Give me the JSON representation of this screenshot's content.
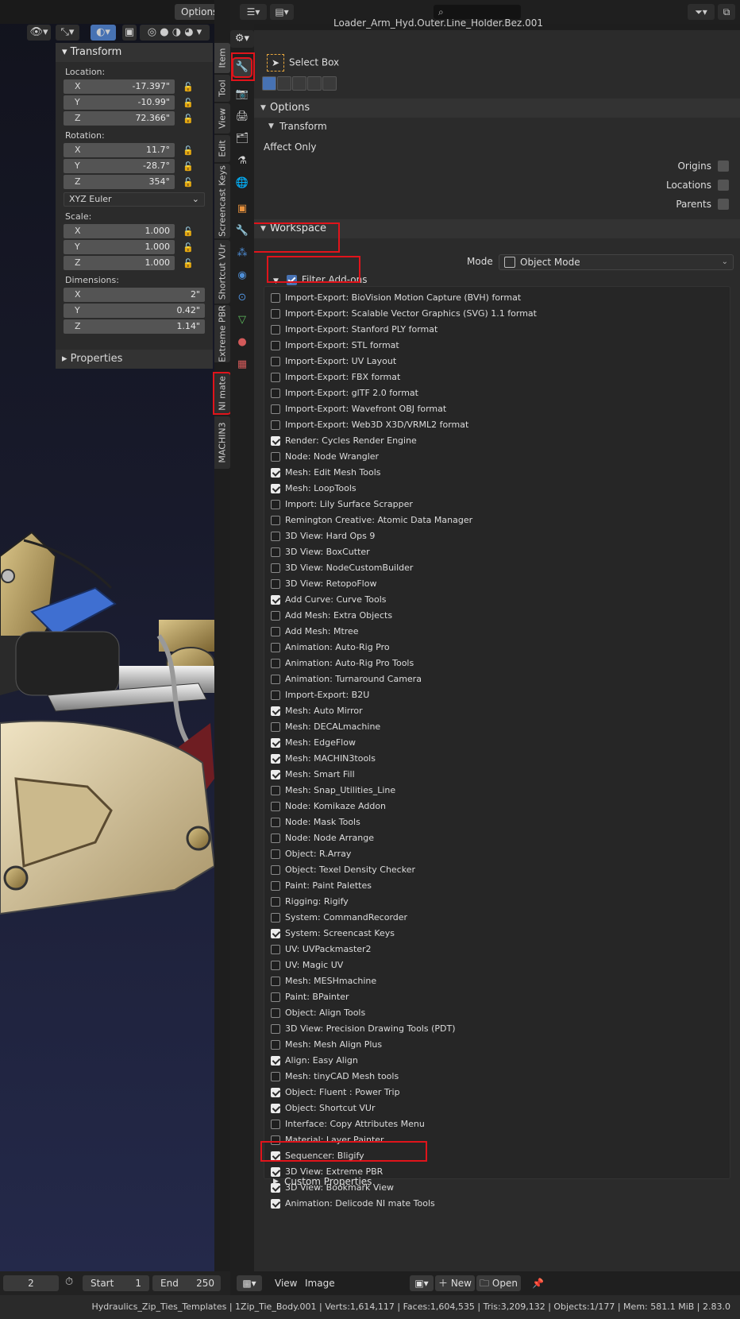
{
  "viewport": {
    "options_label": "Options"
  },
  "npanel": {
    "transform_header": "Transform",
    "location_label": "Location:",
    "location": [
      {
        "axis": "X",
        "value": "-17.397\""
      },
      {
        "axis": "Y",
        "value": "-10.99\""
      },
      {
        "axis": "Z",
        "value": "72.366\""
      }
    ],
    "rotation_label": "Rotation:",
    "rotation": [
      {
        "axis": "X",
        "value": "11.7°"
      },
      {
        "axis": "Y",
        "value": "-28.7°"
      },
      {
        "axis": "Z",
        "value": "354°"
      }
    ],
    "rotation_mode": "XYZ Euler",
    "scale_label": "Scale:",
    "scale": [
      {
        "axis": "X",
        "value": "1.000"
      },
      {
        "axis": "Y",
        "value": "1.000"
      },
      {
        "axis": "Z",
        "value": "1.000"
      }
    ],
    "dimensions_label": "Dimensions:",
    "dimensions": [
      {
        "axis": "X",
        "value": "2\""
      },
      {
        "axis": "Y",
        "value": "0.42\""
      },
      {
        "axis": "Z",
        "value": "1.14\""
      }
    ],
    "properties_header": "Properties"
  },
  "vtabs": [
    "Item",
    "Tool",
    "View",
    "Edit",
    "Screencast Keys",
    "Shortcut VUr",
    "Extreme PBR",
    "NI mate",
    "MACHIN3"
  ],
  "props_header": {
    "breadcrumb": "Loader_Arm_Hyd.Outer.Line_Holder.Bez.001"
  },
  "tool": {
    "active_tool": "Select Box"
  },
  "options": {
    "header": "Options",
    "transform_sub": "Transform",
    "affect_only": "Affect Only",
    "origins": "Origins",
    "locations": "Locations",
    "parents": "Parents"
  },
  "workspace": {
    "header": "Workspace",
    "mode_label": "Mode",
    "mode_value": "Object Mode",
    "filter_addons": "Filter Add-ons"
  },
  "addons": [
    {
      "name": "Import-Export: BioVision Motion Capture (BVH) format",
      "on": false
    },
    {
      "name": "Import-Export: Scalable Vector Graphics (SVG) 1.1 format",
      "on": false
    },
    {
      "name": "Import-Export: Stanford PLY format",
      "on": false
    },
    {
      "name": "Import-Export: STL format",
      "on": false
    },
    {
      "name": "Import-Export: UV Layout",
      "on": false
    },
    {
      "name": "Import-Export: FBX format",
      "on": false
    },
    {
      "name": "Import-Export: glTF 2.0 format",
      "on": false
    },
    {
      "name": "Import-Export: Wavefront OBJ format",
      "on": false
    },
    {
      "name": "Import-Export: Web3D X3D/VRML2 format",
      "on": false
    },
    {
      "name": "Render: Cycles Render Engine",
      "on": true
    },
    {
      "name": "Node: Node Wrangler",
      "on": false
    },
    {
      "name": "Mesh: Edit Mesh Tools",
      "on": true
    },
    {
      "name": "Mesh: LoopTools",
      "on": true
    },
    {
      "name": "Import: Lily Surface Scrapper",
      "on": false
    },
    {
      "name": "Remington Creative: Atomic Data Manager",
      "on": false
    },
    {
      "name": "3D View: Hard Ops 9",
      "on": false
    },
    {
      "name": "3D View: BoxCutter",
      "on": false
    },
    {
      "name": "3D View: NodeCustomBuilder",
      "on": false
    },
    {
      "name": "3D View: RetopoFlow",
      "on": false
    },
    {
      "name": "Add Curve: Curve Tools",
      "on": true
    },
    {
      "name": "Add Mesh: Extra Objects",
      "on": false
    },
    {
      "name": "Add Mesh: Mtree",
      "on": false
    },
    {
      "name": "Animation: Auto-Rig Pro",
      "on": false
    },
    {
      "name": "Animation: Auto-Rig Pro Tools",
      "on": false
    },
    {
      "name": "Animation: Turnaround Camera",
      "on": false
    },
    {
      "name": "Import-Export: B2U",
      "on": false
    },
    {
      "name": "Mesh: Auto Mirror",
      "on": true
    },
    {
      "name": "Mesh: DECALmachine",
      "on": false
    },
    {
      "name": "Mesh: EdgeFlow",
      "on": true
    },
    {
      "name": "Mesh: MACHIN3tools",
      "on": true
    },
    {
      "name": "Mesh: Smart Fill",
      "on": true
    },
    {
      "name": "Mesh: Snap_Utilities_Line",
      "on": false
    },
    {
      "name": "Node: Komikaze Addon",
      "on": false
    },
    {
      "name": "Node: Mask Tools",
      "on": false
    },
    {
      "name": "Node: Node Arrange",
      "on": false
    },
    {
      "name": "Object: R.Array",
      "on": false
    },
    {
      "name": "Object: Texel Density Checker",
      "on": false
    },
    {
      "name": "Paint: Paint Palettes",
      "on": false
    },
    {
      "name": "Rigging: Rigify",
      "on": false
    },
    {
      "name": "System: CommandRecorder",
      "on": false
    },
    {
      "name": "System: Screencast Keys",
      "on": true
    },
    {
      "name": "UV: UVPackmaster2",
      "on": false
    },
    {
      "name": "UV: Magic UV",
      "on": false
    },
    {
      "name": "Mesh: MESHmachine",
      "on": false
    },
    {
      "name": "Paint: BPainter",
      "on": false
    },
    {
      "name": "Object: Align Tools",
      "on": false
    },
    {
      "name": "3D View: Precision Drawing Tools (PDT)",
      "on": false
    },
    {
      "name": "Mesh: Mesh Align Plus",
      "on": false
    },
    {
      "name": "Align: Easy Align",
      "on": true
    },
    {
      "name": "Mesh: tinyCAD Mesh tools",
      "on": false
    },
    {
      "name": "Object: Fluent : Power Trip",
      "on": true
    },
    {
      "name": "Object: Shortcut VUr",
      "on": true
    },
    {
      "name": "Interface: Copy Attributes Menu",
      "on": false
    },
    {
      "name": "Material: Layer Painter",
      "on": false
    },
    {
      "name": "Sequencer: Bligify",
      "on": true
    },
    {
      "name": "3D View: Extreme PBR",
      "on": true
    },
    {
      "name": "3D View: Bookmark View",
      "on": true
    },
    {
      "name": "Animation: Delicode NI mate Tools",
      "on": true
    }
  ],
  "custom_properties": "Custom Properties",
  "timeline": {
    "current_frame": "2",
    "start_label": "Start",
    "start_value": "1",
    "end_label": "End",
    "end_value": "250"
  },
  "image_editor": {
    "view": "View",
    "image": "Image",
    "new": "New",
    "open": "Open"
  },
  "statusbar": "Hydraulics_Zip_Ties_Templates | 1Zip_Tie_Body.001 | Verts:1,614,117 | Faces:1,604,535 | Tris:3,209,132 | Objects:1/177 | Mem: 581.1 MiB | 2.83.0",
  "colors": {
    "highlight": "#e0141b",
    "accent": "#4772b3"
  }
}
